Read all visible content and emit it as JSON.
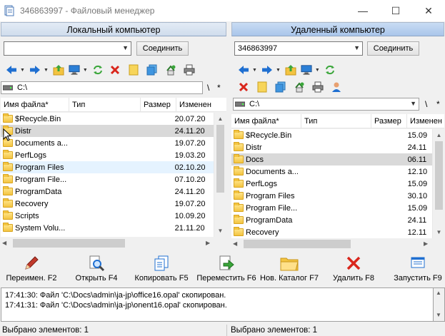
{
  "window": {
    "title": "346863997 - Файловый менеджер",
    "minimize": "—",
    "maximize": "☐",
    "close": "✕"
  },
  "left": {
    "header": "Локальный компьютер",
    "address_value": "",
    "connect_label": "Соединить",
    "drive": "C:\\",
    "root": "\\",
    "star": "*",
    "columns": [
      "Имя файла*",
      "Тип",
      "Размер",
      "Изменен"
    ],
    "rows": [
      {
        "name": "$Recycle.Bin",
        "type": "",
        "size": "",
        "date": "20.07.20"
      },
      {
        "name": "Distr",
        "type": "",
        "size": "",
        "date": "24.11.20"
      },
      {
        "name": "Documents a...",
        "type": "",
        "size": "",
        "date": "19.07.20"
      },
      {
        "name": "PerfLogs",
        "type": "",
        "size": "",
        "date": "19.03.20"
      },
      {
        "name": "Program Files",
        "type": "",
        "size": "",
        "date": "02.10.20"
      },
      {
        "name": "Program File...",
        "type": "",
        "size": "",
        "date": "07.10.20"
      },
      {
        "name": "ProgramData",
        "type": "",
        "size": "",
        "date": "24.11.20"
      },
      {
        "name": "Recovery",
        "type": "",
        "size": "",
        "date": "19.07.20"
      },
      {
        "name": "Scripts",
        "type": "",
        "size": "",
        "date": "10.09.20"
      },
      {
        "name": "System Volu...",
        "type": "",
        "size": "",
        "date": "21.11.20"
      }
    ],
    "status": "Выбрано элементов: 1"
  },
  "right": {
    "header": "Удаленный компьютер",
    "address_value": "346863997",
    "connect_label": "Соединить",
    "drive": "C:\\",
    "root": "\\",
    "star": "*",
    "columns": [
      "Имя файла*",
      "Тип",
      "Размер",
      "Изменен"
    ],
    "rows": [
      {
        "name": "$Recycle.Bin",
        "type": "",
        "size": "",
        "date": "15.09"
      },
      {
        "name": "Distr",
        "type": "",
        "size": "",
        "date": "24.11"
      },
      {
        "name": "Docs",
        "type": "",
        "size": "",
        "date": "06.11"
      },
      {
        "name": "Documents a...",
        "type": "",
        "size": "",
        "date": "12.10"
      },
      {
        "name": "PerfLogs",
        "type": "",
        "size": "",
        "date": "15.09"
      },
      {
        "name": "Program Files",
        "type": "",
        "size": "",
        "date": "30.10"
      },
      {
        "name": "Program File...",
        "type": "",
        "size": "",
        "date": "15.09"
      },
      {
        "name": "ProgramData",
        "type": "",
        "size": "",
        "date": "24.11"
      },
      {
        "name": "Recovery",
        "type": "",
        "size": "",
        "date": "12.11"
      }
    ],
    "status": "Выбрано элементов: 1"
  },
  "actions": {
    "rename": "Переимен. F2",
    "open": "Открыть F4",
    "copy": "Копировать F5",
    "move": "Переместить F6",
    "newdir": "Нов. Каталог F7",
    "delete": "Удалить F8",
    "run": "Запустить F9"
  },
  "log": [
    "17:41:30: Файл 'C:\\Docs\\admin\\ja-jp\\office16.opal' скопирован.",
    "17:41:31: Файл 'C:\\Docs\\admin\\ja-jp\\onent16.opal' скопирован."
  ],
  "colors": {
    "blue_arrow": "#1f6fd1",
    "green": "#3aa63a",
    "red": "#d9261c",
    "folder": "#f3c441",
    "selection": "#d9d9d9"
  }
}
